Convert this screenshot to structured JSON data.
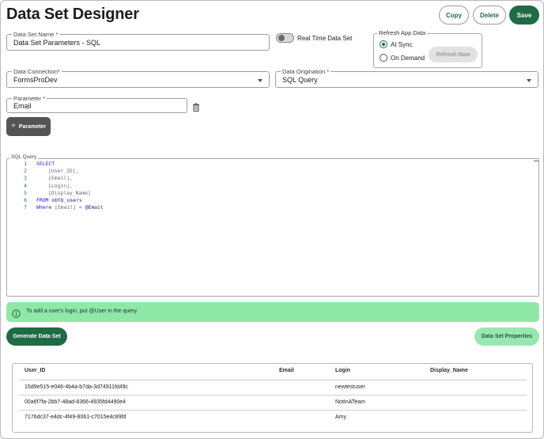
{
  "page": {
    "title": "Data Set Designer"
  },
  "toolbar": {
    "copy_label": "Copy",
    "delete_label": "Delete",
    "save_label": "Save"
  },
  "form": {
    "name": {
      "label": "Data Set Name *",
      "value": "Data Set Parameters - SQL"
    },
    "realtime": {
      "label": "Real Time Data Set",
      "on": false
    },
    "refresh": {
      "legend": "Refresh App Data",
      "options": [
        "At Sync",
        "On Demand"
      ],
      "selected": "At Sync",
      "refresh_now_label": "Refresh Now"
    },
    "connection": {
      "label": "Data Connection*",
      "value": "FormsProDev"
    },
    "origination": {
      "label": "Data Origination *",
      "value": "SQL Query"
    },
    "parameter": {
      "label": "Parameter *",
      "value": "Email"
    },
    "add_parameter_label": "Parameter"
  },
  "sql": {
    "label": "SQL Query",
    "lines": [
      "1",
      "2",
      "3",
      "4",
      "5",
      "6",
      "7"
    ],
    "tokens": {
      "select": "SELECT",
      "user_id": "[User_ID],",
      "email": "[Email],",
      "login": "[Login],",
      "display": "[Display_Name]",
      "from": "FROM",
      "table": "obtb_users",
      "where": "Where",
      "where_col": "[Email]",
      "eq": "=",
      "param": "@Email"
    }
  },
  "info": {
    "text": "To add a user's login, put @User in the query."
  },
  "actions": {
    "generate_label": "Generate Data Set",
    "properties_label": "Data Set Properties"
  },
  "table": {
    "columns": [
      "User_ID",
      "Email",
      "Login",
      "Display_Name"
    ],
    "rows": [
      [
        "15d9e515-e046-4b4a-b7da-3d74911fd49c",
        "",
        "newtestuser",
        ""
      ],
      [
        "00a6f7fa-2bb7-48ad-8366-4935fd4490e4",
        "",
        "NotInATeam",
        ""
      ],
      [
        "7176dc37-e4dc-4f49-8061-c7015e4c89fd",
        "",
        "Amy",
        ""
      ]
    ]
  },
  "colors": {
    "primary": "#1f6b45",
    "info_bg": "#8ee9a6",
    "properties_bg": "#97e7b1"
  },
  "icons": [
    "trash-icon",
    "plus-icon",
    "info-icon",
    "minimize-icon",
    "chevron-down-icon"
  ]
}
